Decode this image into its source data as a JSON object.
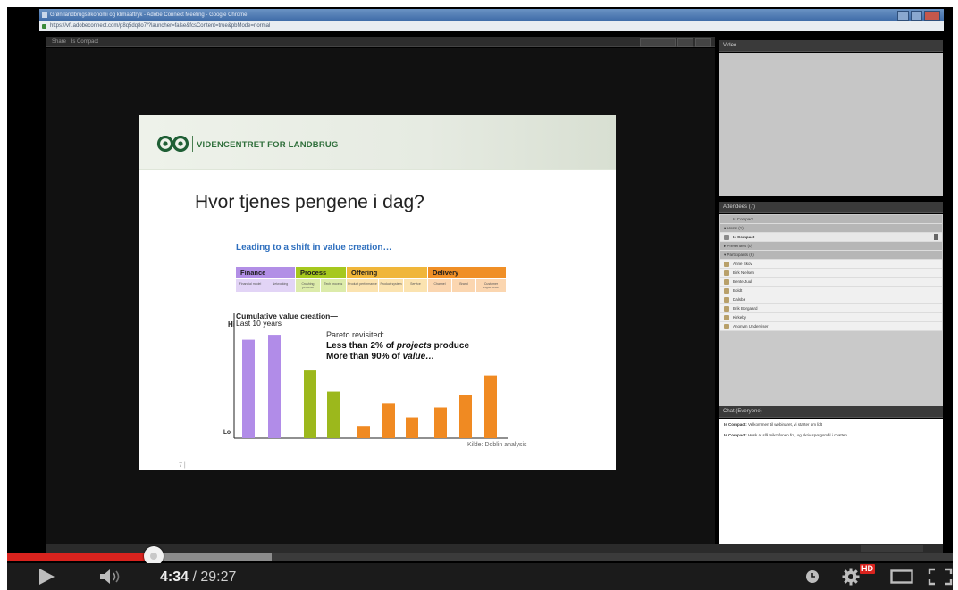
{
  "browser": {
    "title": "Grøn landbrugsøkonomi og klimaaftryk - Adobe Connect Meeting - Google Chrome",
    "url": "https://vfl.adobeconnect.com/p8q5dq8o7/?launcher=false&fcsContent=true&pbMode=normal"
  },
  "connect": {
    "share_pod_title": "Share",
    "share_pod_subtitle": "Is Compact",
    "video_pod_title": "Video",
    "attendees_pod_title": "Attendees (7)",
    "attendees": [
      {
        "label": "Is Compact",
        "kind": "grp"
      },
      {
        "label": "▾ Hosts (1)",
        "kind": "grp"
      },
      {
        "label": "Is Compact",
        "kind": "sel"
      },
      {
        "label": "▸ Presenters (0)",
        "kind": "grp"
      },
      {
        "label": "▾ Participants (6)",
        "kind": "grp"
      },
      {
        "label": "Anne Skov",
        "kind": "user"
      },
      {
        "label": "Birk Nielsen",
        "kind": "user"
      },
      {
        "label": "Bente Juul",
        "kind": "user"
      },
      {
        "label": "Boldt",
        "kind": "user"
      },
      {
        "label": "Dalsbø",
        "kind": "user"
      },
      {
        "label": "Erik Borgaard",
        "kind": "user"
      },
      {
        "label": "Kirkeby",
        "kind": "user"
      },
      {
        "label": "Anonym Underviser",
        "kind": "user"
      }
    ],
    "chat_pod_title": "Chat (Everyone)",
    "chat_messages": [
      {
        "author": "Is Compact:",
        "text": "Velkommen til webinaret, vi starter om lidt"
      },
      {
        "author": "Is Compact:",
        "text": "Husk at slå mikrofonen fra, og skriv spørgsmål i chatten"
      }
    ]
  },
  "slide": {
    "logo_text": "VIDENCENTRET FOR LANDBRUG",
    "title": "Hvor tjenes pengene i dag?",
    "chart_headline": "Leading to a shift in value creation…",
    "phases": [
      {
        "label": "Finance",
        "color": "#b28fe6",
        "subs": [
          "Financial model",
          "Networking"
        ]
      },
      {
        "label": "Process",
        "color": "#a6c81e",
        "subs": [
          "Crushing process",
          "Tech process"
        ]
      },
      {
        "label": "Offering",
        "color": "#f0b63a",
        "subs": [
          "Product performance",
          "Product system",
          "Service"
        ]
      },
      {
        "label": "Delivery",
        "color": "#f08f26",
        "subs": [
          "Channel",
          "Brand",
          "Customer experience"
        ]
      }
    ],
    "cumulative_label": "Cumulative value creation—",
    "cumulative_sub": "Last 10 years",
    "pareto_title": "Pareto revisited:",
    "pareto_line1_pre": "Less than 2% of ",
    "pareto_line1_em": "projects",
    "pareto_line1_post": " produce",
    "pareto_line2_pre": "More than 90% of ",
    "pareto_line2_em": "value…",
    "axis_hi": "Hi",
    "axis_lo": "Lo",
    "source": "Kilde: Doblin analysis",
    "page_number": "7"
  },
  "chart_data": {
    "type": "bar",
    "title": "Cumulative value creation— Last 10 years",
    "ylabel_top": "Hi",
    "ylabel_bottom": "Lo",
    "categories": [
      "Financial model",
      "Networking",
      "Enabling process",
      "Core process",
      "Product performance",
      "Product system",
      "Service",
      "Channel",
      "Brand",
      "Customer experience"
    ],
    "values": [
      80,
      84,
      55,
      38,
      10,
      28,
      17,
      25,
      35,
      51
    ],
    "colors": [
      "#b18ce8",
      "#b18ce8",
      "#9cb81c",
      "#9cb81c",
      "#f08a22",
      "#f08a22",
      "#f08a22",
      "#f08a22",
      "#f08a22",
      "#f08a22"
    ],
    "ylim": [
      0,
      100
    ]
  },
  "player": {
    "current_time": "4:34",
    "duration": "29:27",
    "separator": " / ",
    "played_fraction": 0.155,
    "buffered_fraction": 0.28,
    "hd_badge": "HD",
    "accent": "#d9231e"
  }
}
